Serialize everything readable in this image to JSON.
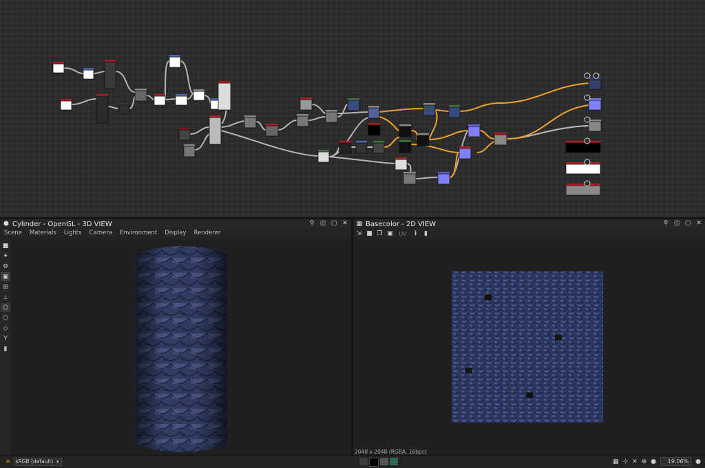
{
  "graph": {
    "label": "node graph"
  },
  "view3d": {
    "title": "Cylinder - OpenGL - 3D VIEW",
    "menus": [
      "Scene",
      "Materials",
      "Lights",
      "Camera",
      "Environment",
      "Display",
      "Renderer"
    ],
    "tool_icons": [
      "camera-icon",
      "light-icon",
      "environment-icon",
      "display-icon",
      "grid-icon",
      "axis-icon",
      "cube-icon",
      "cube-outline-icon",
      "layers-icon",
      "branch-icon",
      "chart-icon"
    ]
  },
  "view2d": {
    "title": "Basecolor - 2D VIEW",
    "toolbar_icons": [
      "export-icon",
      "save-icon",
      "copy-icon",
      "snapshot-icon",
      "uv-icon",
      "info-icon",
      "histogram-icon"
    ],
    "uv_label": "UV",
    "status": "2048 x 2048 (RGBA, 16bpc)"
  },
  "statusbar": {
    "colorspace": "sRGB (default)",
    "zoom": "19.06%"
  },
  "colors": {
    "accent_orange": "#f0a12a",
    "texture_blue": "#2f3a66",
    "node_red": "#a3141c"
  }
}
